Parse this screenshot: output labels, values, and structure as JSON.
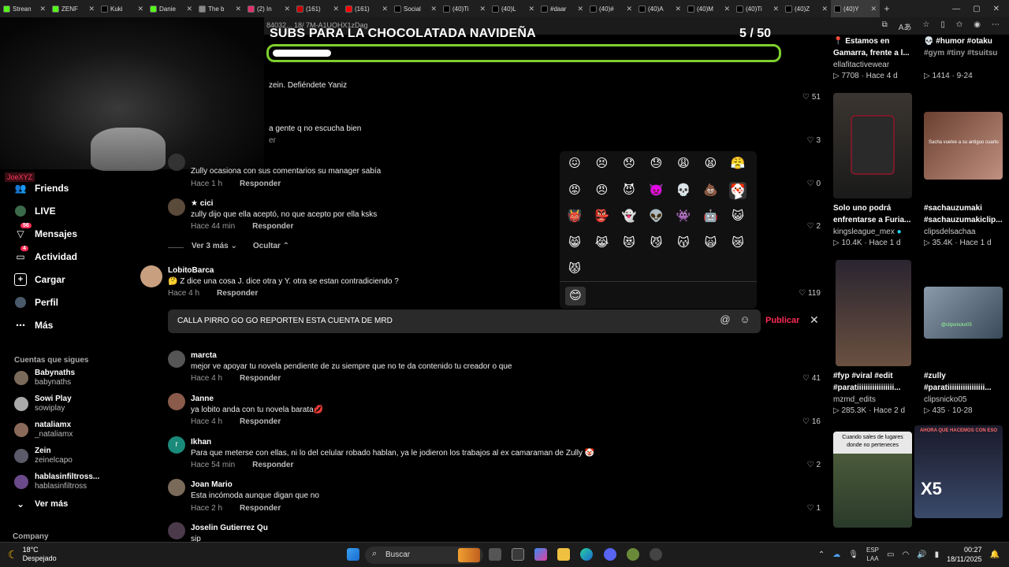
{
  "browser": {
    "tabs": [
      {
        "title": "Strean",
        "color": "#53fc18"
      },
      {
        "title": "ZENF",
        "color": "#53fc18"
      },
      {
        "title": "Kuki",
        "color": "#000000"
      },
      {
        "title": "Danie",
        "color": "#53fc18"
      },
      {
        "title": "The b",
        "color": "#888888"
      },
      {
        "title": "(2) In",
        "color": "#e1306c"
      },
      {
        "title": "(161)",
        "color": "#cc0000"
      },
      {
        "title": "(161)",
        "color": "#ff0000"
      },
      {
        "title": "Social",
        "color": "#000000"
      },
      {
        "title": "(40)Ti",
        "color": "#000000"
      },
      {
        "title": "(40)L",
        "color": "#000000"
      },
      {
        "title": "#daar",
        "color": "#000000"
      },
      {
        "title": "(40)#",
        "color": "#000000"
      },
      {
        "title": "(40)A",
        "color": "#000000"
      },
      {
        "title": "(40)M",
        "color": "#000000"
      },
      {
        "title": "(40)Ti",
        "color": "#000000"
      },
      {
        "title": "(40)Z",
        "color": "#000000"
      },
      {
        "title": "(40)Y",
        "color": "#000000",
        "active": true
      }
    ],
    "url_fragment": "84032... 18/ 7M-A1UOHX1zDag"
  },
  "overlay": {
    "subs_title": "SUBS PARA LA CHOCOLATADA NAVIDEÑA",
    "subs_count": "5  / 50",
    "progress_fraction": 0.1,
    "progress_color": "#7fcf2f",
    "streamer_tag": "JoeXYZ"
  },
  "leftnav": {
    "items": [
      {
        "label": "Friends",
        "icon": "friends-icon"
      },
      {
        "label": "LIVE",
        "icon": "live-icon"
      },
      {
        "label": "Mensajes",
        "icon": "messages-icon",
        "badge": "56"
      },
      {
        "label": "Actividad",
        "icon": "activity-icon",
        "badge": "4"
      },
      {
        "label": "Cargar",
        "icon": "upload-icon"
      },
      {
        "label": "Perfil",
        "icon": "profile-icon"
      },
      {
        "label": "Más",
        "icon": "more-icon"
      }
    ],
    "following_heading": "Cuentas que sigues",
    "following": [
      {
        "name": "Babynaths",
        "handle": "babynaths",
        "color": "#7a6a5a"
      },
      {
        "name": "Sowi Play",
        "handle": "sowiplay",
        "color": "#aaaaaa"
      },
      {
        "name": "nataliamx",
        "handle": "_nataliamx",
        "color": "#8a6a5a"
      },
      {
        "name": "Zein",
        "handle": "zeinelcapo",
        "color": "#5a5a6a"
      },
      {
        "name": "hablasinfiltross...",
        "handle": "hablasinfiltross",
        "color": "#6a4a8a"
      }
    ],
    "see_more": "Ver más",
    "company": "Company"
  },
  "comments": [
    {
      "text": "zein. Defiéndete Yaniz",
      "likes": "51"
    },
    {
      "text": "a gente q no escucha bien",
      "likes": "3",
      "meta_tail": "er"
    },
    {
      "text": "Zully ocasiona con sus comentarios su manager sabía",
      "time": "Hace 1 h",
      "reply": "Responder",
      "likes": "0"
    },
    {
      "name": "★ cici",
      "text": "zully dijo que ella aceptó, no que acepto por ella ksks",
      "time": "Hace 44 min",
      "reply": "Responder",
      "likes": "2"
    },
    {
      "name": "LobitoBarca",
      "text": "🤔 Z dice una cosa J. dice otra y Y. otra se estan contradiciendo ?",
      "time": "Hace 4 h",
      "reply": "Responder",
      "likes": "119"
    },
    {
      "name": "marcta",
      "text": "mejor ve apoyar tu novela pendiente de zu siempre que no te da contenido tu creador o que",
      "time": "Hace 4 h",
      "reply": "Responder",
      "likes": "41"
    },
    {
      "name": "Janne",
      "text": "ya lobito anda con tu novela barata💋",
      "time": "Hace 4 h",
      "reply": "Responder",
      "likes": "16"
    },
    {
      "name": "Ikhan",
      "text": "Para que meterse con ellas, ni lo del celular robado hablan, ya le jodieron los trabajos al ex camaraman de Zully 🤡",
      "time": "Hace 54 min",
      "reply": "Responder",
      "likes": "2"
    },
    {
      "name": "Joan Mario",
      "text": "Esta incómoda aunque digan que no",
      "time": "Hace 2 h",
      "reply": "Responder",
      "likes": "1"
    },
    {
      "name": "Joselin Gutierrez Qu",
      "text": "sip"
    }
  ],
  "replies_toggle": {
    "more": "Ver 3 más",
    "hide": "Ocultar"
  },
  "reply_input": {
    "value": "CALLA PIRRO GO GO REPORTEN ESTA CUENTA DE MRD",
    "submit": "Publicar"
  },
  "emoji_picker": {
    "rows": [
      [
        "😖",
        "😣",
        "😞",
        "😓",
        "😩",
        "😫",
        "😤"
      ],
      [
        "😡",
        "😠",
        "😈",
        "👿",
        "💀",
        "💩",
        "🤡"
      ],
      [
        "👹",
        "👺",
        "👻",
        "👽",
        "👾",
        "🤖",
        "😺"
      ],
      [
        "😸",
        "😹",
        "😻",
        "😼",
        "😽",
        "🙀",
        "😿"
      ],
      [
        "😾"
      ]
    ],
    "selected_tab": "😊"
  },
  "right_videos": [
    {
      "caption1": "📍 Estamos en",
      "caption2": "Gamarra, frente a l...",
      "author": "ellafitactivewear",
      "views": "7708",
      "time": "Hace 4 d"
    },
    {
      "caption1": "💀 #humor #otaku",
      "caption2": "#gym #tiny #tsuitsu",
      "author": "",
      "views": "1414",
      "time": "9-24"
    },
    {
      "caption1": "Solo uno podrá",
      "caption2": "enfrentarse a Furia...",
      "author": "kingsleague_mex",
      "views": "10.4K",
      "time": "Hace 1 d",
      "thumb_text": ""
    },
    {
      "caption1": "#sachauzumaki",
      "caption2": "#sachauzumakiclip...",
      "author": "clipsdelsachaa",
      "views": "35.4K",
      "time": "Hace 1 d",
      "thumb_text": "Sacha vuelve a su antiguo cuarto"
    },
    {
      "caption1": "#fyp #viral #edit",
      "caption2": "#paratiiiiiiiiiiiiiiiii...",
      "author": "mzmd_edits",
      "views": "285.3K",
      "time": "Hace 2 d"
    },
    {
      "caption1": "#zully",
      "caption2": "#paratiiiiiiiiiiiiiiiii...",
      "author": "clipsnicko05",
      "views": "435",
      "time": "10-28",
      "thumb_text": "@clipsnicko05"
    },
    {
      "thumb_text": "Cuando sales de lugares donde no perteneces"
    },
    {
      "thumb_text": "AHORA QUE HACEMOS CON ESO",
      "thumb_big": "X5"
    }
  ],
  "taskbar": {
    "weather_temp": "18°C",
    "weather_desc": "Despejado",
    "search": "Buscar",
    "lang1": "ESP",
    "lang2": "LAA",
    "time": "00:27",
    "date": "18/11/2025"
  }
}
